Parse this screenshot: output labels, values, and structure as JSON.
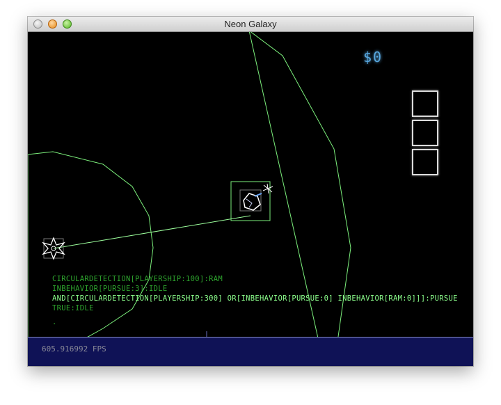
{
  "window": {
    "title": "Neon Galaxy"
  },
  "hud": {
    "money": "$0",
    "inventory_slots": 3
  },
  "debug": {
    "lines": [
      "CIRCULARDETECTION[PLAYERSHIP:100]:RAM",
      "INBEHAVIOR[PURSUE:3]:IDLE",
      "AND[CIRCULARDETECTION[PLAYERSHIP:300] OR[INBEHAVIOR[PURSUE:0] INBEHAVIOR[RAM:0]]]:PURSUE",
      "TRUE:IDLE",
      "."
    ]
  },
  "status": {
    "fps": "605.916992 FPS"
  },
  "colors": {
    "detection_circle": "#7cf07c",
    "debug_dim": "#2ea52e",
    "debug_bright": "#8cff8c",
    "money": "#58a8e0",
    "bottom_bar": "#0f1256"
  }
}
